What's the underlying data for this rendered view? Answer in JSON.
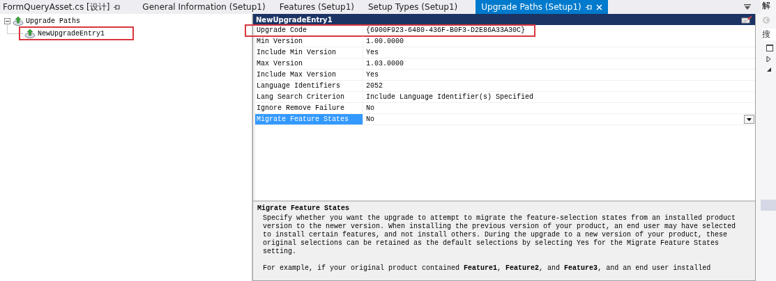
{
  "tabs": [
    {
      "label": "FormQueryAsset.cs [设计]",
      "selected": false,
      "pinned": true
    },
    {
      "label": "General Information (Setup1)",
      "selected": false,
      "pinned": false
    },
    {
      "label": "Features (Setup1)",
      "selected": false,
      "pinned": false
    },
    {
      "label": "Setup Types (Setup1)",
      "selected": false,
      "pinned": false
    },
    {
      "label": "Upgrade Paths (Setup1)",
      "selected": true,
      "pinned": true
    }
  ],
  "tree": {
    "label": "Upgrade Paths",
    "expanded": true,
    "children": [
      {
        "label": "NewUpgradeEntry1",
        "highlighted": true
      }
    ]
  },
  "properties": {
    "title": "NewUpgradeEntry1",
    "rows": [
      {
        "name": "Upgrade Code",
        "value": "{6900F923-6480-436F-B0F3-D2E86A33A30C}",
        "selected": false,
        "highlighted": true
      },
      {
        "name": "Min Version",
        "value": "1.00.0000",
        "selected": false,
        "highlighted": false
      },
      {
        "name": "Include Min Version",
        "value": "Yes",
        "selected": false,
        "highlighted": false
      },
      {
        "name": "Max Version",
        "value": "1.03.0000",
        "selected": false,
        "highlighted": false
      },
      {
        "name": "Include Max Version",
        "value": "Yes",
        "selected": false,
        "highlighted": false
      },
      {
        "name": "Language Identifiers",
        "value": "2052",
        "selected": false,
        "highlighted": false
      },
      {
        "name": "Lang Search Criterion",
        "value": "Include Language Identifier(s) Specified",
        "selected": false,
        "highlighted": false
      },
      {
        "name": "Ignore Remove Failure",
        "value": "No",
        "selected": false,
        "highlighted": false
      },
      {
        "name": "Migrate Feature States",
        "value": "No",
        "selected": true,
        "highlighted": false
      }
    ],
    "description": {
      "title": "Migrate Feature States",
      "paragraphs": [
        "Specify whether you want the upgrade to attempt to migrate the feature-selection states from an installed product version to the newer version. When installing the previous version of your product, an end user may have selected to install certain features, and not install others. During the upgrade to a new version of your product, these original selections can be retained as the default selections by selecting Yes for the Migrate Feature States setting.",
        "For example, if your original product contained **Feature1**, **Feature2**, and **Feature3**, and an end user installed"
      ]
    }
  },
  "side_panel": {
    "title": "解",
    "search_placeholder": "搜"
  }
}
